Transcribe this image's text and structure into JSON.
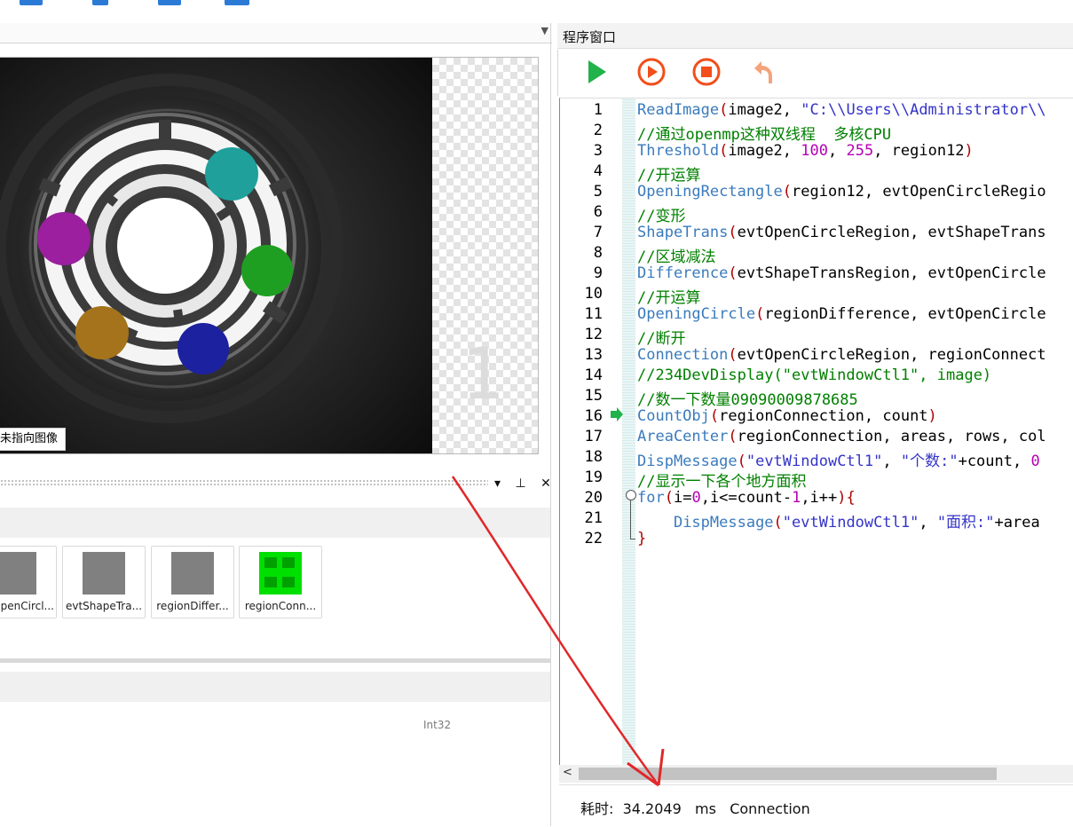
{
  "left_panel": {
    "image_tooltip": "未指向图像",
    "thumbnails": [
      {
        "label": "OpenCircl...",
        "kind": "gray"
      },
      {
        "label": "evtShapeTra...",
        "kind": "gray"
      },
      {
        "label": "regionDiffer...",
        "kind": "gray"
      },
      {
        "label": "regionConn...",
        "kind": "green"
      }
    ],
    "type_label": "Int32",
    "panel_controls": "▾ ⊥ ✕",
    "watermark_text": "1",
    "region_colors": [
      "#1fa09b",
      "#9b1f9f",
      "#1f9f22",
      "#a4731b",
      "#1c219f"
    ]
  },
  "program_window": {
    "title": "程序窗口",
    "toolbar": [
      {
        "name": "run",
        "icon": "play-icon",
        "color": "#21b24b"
      },
      {
        "name": "step",
        "icon": "step-run-icon",
        "color": "#f24e1b"
      },
      {
        "name": "stop",
        "icon": "stop-icon",
        "color": "#f24e1b"
      },
      {
        "name": "undo",
        "icon": "undo-icon",
        "color": "#f5a37a"
      }
    ],
    "current_line": 16,
    "lines": [
      {
        "n": "1",
        "parts": [
          [
            "kw",
            "ReadImage"
          ],
          [
            "br",
            "("
          ],
          [
            "pl",
            "image2, "
          ],
          [
            "st",
            "\"C:\\\\Users\\\\Administrator\\\\"
          ]
        ]
      },
      {
        "n": "2",
        "parts": [
          [
            "cm",
            "//通过openmp这种双线程  多核CPU"
          ]
        ]
      },
      {
        "n": "3",
        "parts": [
          [
            "kw",
            "Threshold"
          ],
          [
            "br",
            "("
          ],
          [
            "pl",
            "image2, "
          ],
          [
            "nu",
            "100"
          ],
          [
            "pl",
            ", "
          ],
          [
            "nu",
            "255"
          ],
          [
            "pl",
            ", region12"
          ],
          [
            "br",
            ")"
          ]
        ]
      },
      {
        "n": "4",
        "parts": [
          [
            "cm",
            "//开运算"
          ]
        ]
      },
      {
        "n": "5",
        "parts": [
          [
            "kw",
            "OpeningRectangle"
          ],
          [
            "br",
            "("
          ],
          [
            "pl",
            "region12, evtOpenCircleRegio"
          ]
        ]
      },
      {
        "n": "6",
        "parts": [
          [
            "cm",
            "//变形"
          ]
        ]
      },
      {
        "n": "7",
        "parts": [
          [
            "kw",
            "ShapeTrans"
          ],
          [
            "br",
            "("
          ],
          [
            "pl",
            "evtOpenCircleRegion, evtShapeTrans"
          ]
        ]
      },
      {
        "n": "8",
        "parts": [
          [
            "cm",
            "//区域减法"
          ]
        ]
      },
      {
        "n": "9",
        "parts": [
          [
            "kw",
            "Difference"
          ],
          [
            "br",
            "("
          ],
          [
            "pl",
            "evtShapeTransRegion, evtOpenCircle"
          ]
        ]
      },
      {
        "n": "10",
        "parts": [
          [
            "cm",
            "//开运算"
          ]
        ]
      },
      {
        "n": "11",
        "parts": [
          [
            "kw",
            "OpeningCircle"
          ],
          [
            "br",
            "("
          ],
          [
            "pl",
            "regionDifference, evtOpenCircle"
          ]
        ]
      },
      {
        "n": "12",
        "parts": [
          [
            "cm",
            "//断开"
          ]
        ]
      },
      {
        "n": "13",
        "parts": [
          [
            "kw",
            "Connection"
          ],
          [
            "br",
            "("
          ],
          [
            "pl",
            "evtOpenCircleRegion, regionConnect"
          ]
        ]
      },
      {
        "n": "14",
        "parts": [
          [
            "cm",
            "//234DevDisplay(\"evtWindowCtl1\", image)"
          ]
        ]
      },
      {
        "n": "15",
        "parts": [
          [
            "cm",
            "//数一下数量09090009878685"
          ]
        ]
      },
      {
        "n": "16",
        "parts": [
          [
            "kw",
            "CountObj"
          ],
          [
            "br",
            "("
          ],
          [
            "pl",
            "regionConnection, count"
          ],
          [
            "br",
            ")"
          ]
        ]
      },
      {
        "n": "17",
        "parts": [
          [
            "kw",
            "AreaCenter"
          ],
          [
            "br",
            "("
          ],
          [
            "pl",
            "regionConnection, areas, rows, col"
          ]
        ]
      },
      {
        "n": "18",
        "parts": [
          [
            "kw",
            "DispMessage"
          ],
          [
            "br",
            "("
          ],
          [
            "st",
            "\"evtWindowCtl1\""
          ],
          [
            "pl",
            ", "
          ],
          [
            "st",
            "\"个数:\""
          ],
          [
            "pl",
            "+count, "
          ],
          [
            "nu",
            "0"
          ]
        ]
      },
      {
        "n": "19",
        "parts": [
          [
            "cm",
            "//显示一下各个地方面积"
          ]
        ]
      },
      {
        "n": "20",
        "parts": [
          [
            "kw",
            "for"
          ],
          [
            "br",
            "("
          ],
          [
            "pl",
            "i="
          ],
          [
            "nu",
            "0"
          ],
          [
            "pl",
            ",i<=count-"
          ],
          [
            "nu",
            "1"
          ],
          [
            "pl",
            ",i++"
          ],
          [
            "br",
            ")"
          ],
          [
            "br",
            "{"
          ]
        ]
      },
      {
        "n": "21",
        "parts": [
          [
            "pl",
            "    "
          ],
          [
            "kw",
            "DispMessage"
          ],
          [
            "br",
            "("
          ],
          [
            "st",
            "\"evtWindowCtl1\""
          ],
          [
            "pl",
            ", "
          ],
          [
            "st",
            "\"面积:\""
          ],
          [
            "pl",
            "+area"
          ]
        ]
      },
      {
        "n": "22",
        "parts": [
          [
            "br",
            "}"
          ]
        ]
      }
    ],
    "status": {
      "label": "耗时:",
      "value": "34.2049",
      "unit": "ms",
      "operator": "Connection"
    }
  }
}
